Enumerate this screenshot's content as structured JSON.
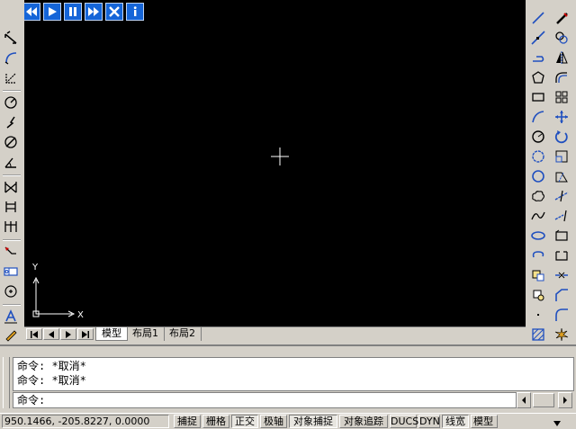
{
  "playback": {
    "icons": [
      "skip-to-start-icon",
      "rewind-icon",
      "play-icon",
      "pause-icon",
      "fast-forward-icon",
      "close-icon",
      "info-icon"
    ]
  },
  "ucs": {
    "x_label": "X",
    "y_label": "Y"
  },
  "layout_tabs": {
    "tabs": [
      {
        "label": "模型",
        "active": true
      },
      {
        "label": "布局1",
        "active": false
      },
      {
        "label": "布局2",
        "active": false
      }
    ]
  },
  "command": {
    "history": [
      "命令: *取消*",
      "命令: *取消*"
    ],
    "prompt": "命令:"
  },
  "status_bar": {
    "coordinates": "950.1466,  -205.8227, 0.0000",
    "toggles": [
      {
        "label": "捕捉",
        "on": false
      },
      {
        "label": "栅格",
        "on": false
      },
      {
        "label": "正交",
        "on": true
      },
      {
        "label": "极轴",
        "on": false
      },
      {
        "label": "对象捕捉",
        "on": true
      },
      {
        "label": "对象追踪",
        "on": false
      },
      {
        "label": "DUCS",
        "on": false
      },
      {
        "label": "DYN",
        "on": false
      },
      {
        "label": "线宽",
        "on": true
      },
      {
        "label": "模型",
        "on": false
      }
    ]
  },
  "colors": {
    "canvas": "#000000",
    "chrome": "#d4d0c8",
    "playback_blue": "#1565d8",
    "icon_blue": "#1f4fbf"
  }
}
